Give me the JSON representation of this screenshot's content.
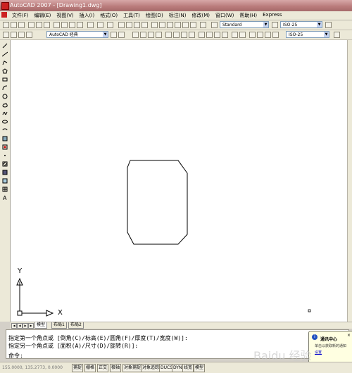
{
  "window": {
    "title": "AutoCAD 2007 - [Drawing1.dwg]"
  },
  "menu": [
    "文件(F)",
    "编辑(E)",
    "视图(V)",
    "插入(I)",
    "格式(O)",
    "工具(T)",
    "绘图(D)",
    "标注(N)",
    "修改(M)",
    "窗口(W)",
    "帮助(H)",
    "Express"
  ],
  "toolbar": {
    "text_style": "Standard",
    "dim_style": "ISO-25",
    "workspace": "AutoCAD 经典",
    "dim_style_2": "ISO-25"
  },
  "layout_tabs": [
    "模型",
    "布局1",
    "布局2"
  ],
  "command_line": {
    "history": [
      "指定第一个角点或 [倒角(C)/标高(E)/圆角(F)/厚度(T)/宽度(W)]:",
      "指定另一个角点或 [面积(A)/尺寸(D)/旋转(R)]:"
    ],
    "prompt": "命令:"
  },
  "status": {
    "coordinates": "155.0000, 135.2773, 0.0000",
    "toggles": [
      "捕捉",
      "栅格",
      "正交",
      "极轴",
      "对象捕捉",
      "对象追踪",
      "DUCS",
      "DYN",
      "线宽",
      "模型"
    ]
  },
  "ucs": {
    "x_label": "X",
    "y_label": "Y"
  },
  "notification": {
    "title": "通讯中心",
    "text": "单击以获取新的通知",
    "link": "设置"
  },
  "watermark": "Baidu 经验",
  "colors": {
    "title_bar": "#b87a7a",
    "canvas": "#ffffff",
    "chrome": "#ece9d8",
    "link": "#0000cc"
  }
}
